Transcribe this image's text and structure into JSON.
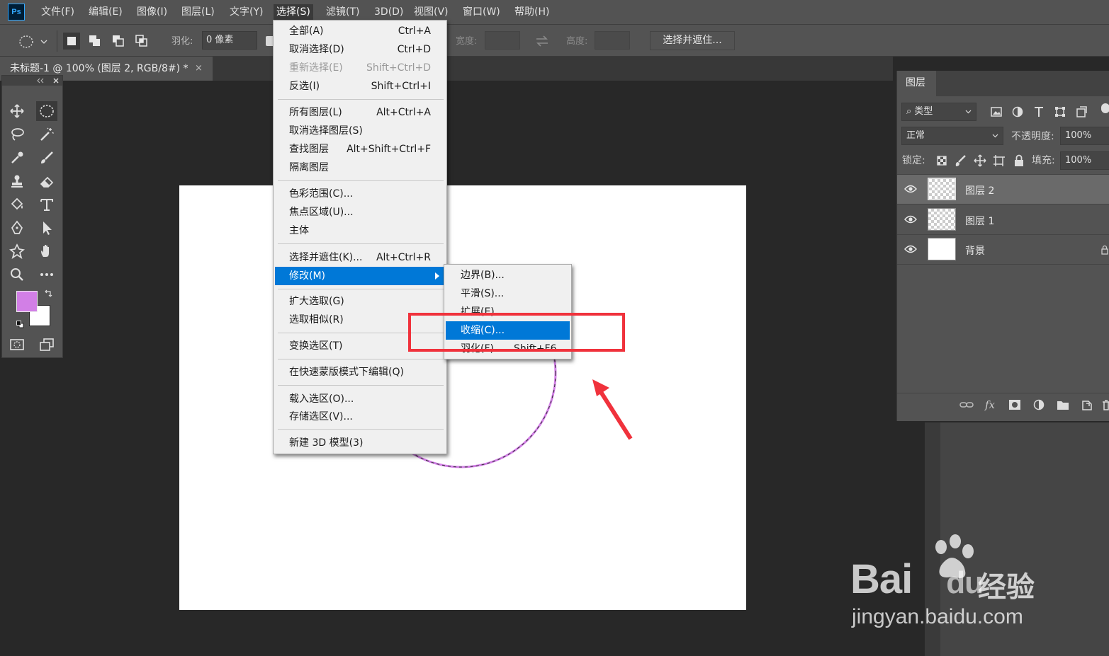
{
  "app": {
    "logo": "Ps"
  },
  "menubar": {
    "items": [
      "文件(F)",
      "编辑(E)",
      "图像(I)",
      "图层(L)",
      "文字(Y)",
      "选择(S)",
      "滤镜(T)",
      "3D(D)",
      "视图(V)",
      "窗口(W)",
      "帮助(H)"
    ],
    "active": "选择(S)"
  },
  "options": {
    "feather_label": "羽化:",
    "feather_value": "0 像素",
    "width_label": "宽度:",
    "height_label": "高度:",
    "select_mask_button": "选择并遮住..."
  },
  "document": {
    "tab_title": "未标题-1 @ 100% (图层 2, RGB/8#) *",
    "close_glyph": "×"
  },
  "toolbox": {
    "foreground_color": "#d27fe6",
    "background_color": "#ffffff"
  },
  "select_menu": {
    "items": [
      {
        "label": "全部(A)",
        "shortcut": "Ctrl+A"
      },
      {
        "label": "取消选择(D)",
        "shortcut": "Ctrl+D"
      },
      {
        "label": "重新选择(E)",
        "shortcut": "Shift+Ctrl+D",
        "disabled": true
      },
      {
        "label": "反选(I)",
        "shortcut": "Shift+Ctrl+I"
      },
      {
        "label": "所有图层(L)",
        "shortcut": "Alt+Ctrl+A"
      },
      {
        "label": "取消选择图层(S)",
        "shortcut": ""
      },
      {
        "label": "查找图层",
        "shortcut": "Alt+Shift+Ctrl+F"
      },
      {
        "label": "隔离图层",
        "shortcut": ""
      },
      {
        "label": "色彩范围(C)...",
        "shortcut": ""
      },
      {
        "label": "焦点区域(U)...",
        "shortcut": ""
      },
      {
        "label": "主体",
        "shortcut": ""
      },
      {
        "label": "选择并遮住(K)...",
        "shortcut": "Alt+Ctrl+R"
      },
      {
        "label": "修改(M)",
        "shortcut": "",
        "highlight": true,
        "submenu": true
      },
      {
        "label": "扩大选取(G)",
        "shortcut": ""
      },
      {
        "label": "选取相似(R)",
        "shortcut": ""
      },
      {
        "label": "变换选区(T)",
        "shortcut": ""
      },
      {
        "label": "在快速蒙版模式下编辑(Q)",
        "shortcut": ""
      },
      {
        "label": "载入选区(O)...",
        "shortcut": ""
      },
      {
        "label": "存储选区(V)...",
        "shortcut": ""
      },
      {
        "label": "新建 3D 模型(3)",
        "shortcut": ""
      }
    ]
  },
  "modify_submenu": {
    "items": [
      {
        "label": "边界(B)...",
        "shortcut": ""
      },
      {
        "label": "平滑(S)...",
        "shortcut": ""
      },
      {
        "label": "扩展(E)...",
        "shortcut": ""
      },
      {
        "label": "收缩(C)...",
        "shortcut": "",
        "highlight": true
      },
      {
        "label": "羽化(F)...",
        "shortcut": "Shift+F6"
      }
    ]
  },
  "layers_panel": {
    "tab_label": "图层",
    "filter_label": "类型",
    "blend_mode": "正常",
    "opacity_label": "不透明度:",
    "opacity_value": "100%",
    "lock_label": "锁定:",
    "fill_label": "填充:",
    "fill_value": "100%",
    "layers": [
      {
        "name": "图层 2",
        "selected": true,
        "thumb": "transparent"
      },
      {
        "name": "图层 1",
        "selected": false,
        "thumb": "transparent"
      },
      {
        "name": "背景",
        "selected": false,
        "thumb": "white",
        "locked": true
      }
    ]
  },
  "selection_circle_color": "#d27fe6",
  "annotation_color": "#f0323c",
  "watermark": {
    "brand": "Bai",
    "brand_tail": "du",
    "product": "经验",
    "url": "jingyan.baidu.com"
  }
}
